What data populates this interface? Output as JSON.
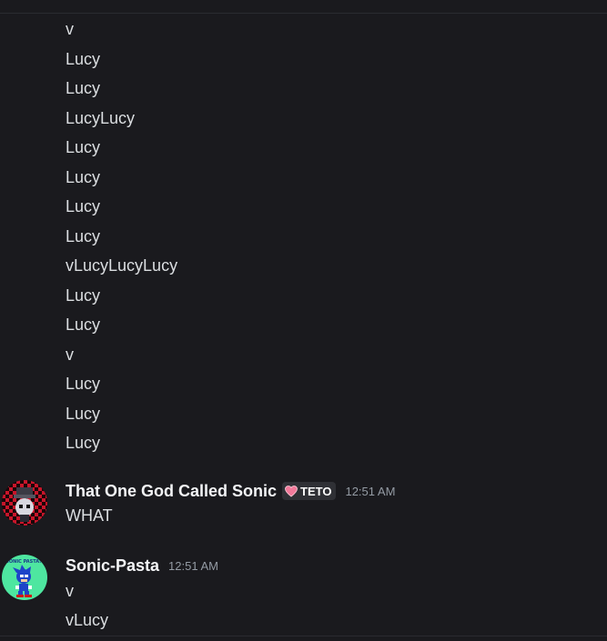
{
  "messages_top": [
    "v",
    "Lucy",
    "Lucy",
    "LucyLucy",
    "Lucy",
    "Lucy",
    "Lucy",
    "Lucy",
    "vLucyLucyLucy",
    "Lucy",
    "Lucy",
    "v",
    "Lucy",
    "Lucy",
    "Lucy"
  ],
  "msg1": {
    "username": "That One God Called Sonic",
    "tag": "TETO",
    "tag_icon": "heart-icon",
    "time": "12:51 AM",
    "lines": [
      "WHAT"
    ]
  },
  "msg2": {
    "username": "Sonic-Pasta",
    "time": "12:51 AM",
    "avatar_text": "SONIC PASTA!!",
    "lines": [
      "v",
      "vLucy"
    ]
  },
  "colors": {
    "background": "#1a1a1e",
    "text": "#dbdee1",
    "username": "#f2f3f5",
    "timestamp": "#949ba4",
    "tag_bg": "#2f3035",
    "heart": "#f27a9b"
  }
}
